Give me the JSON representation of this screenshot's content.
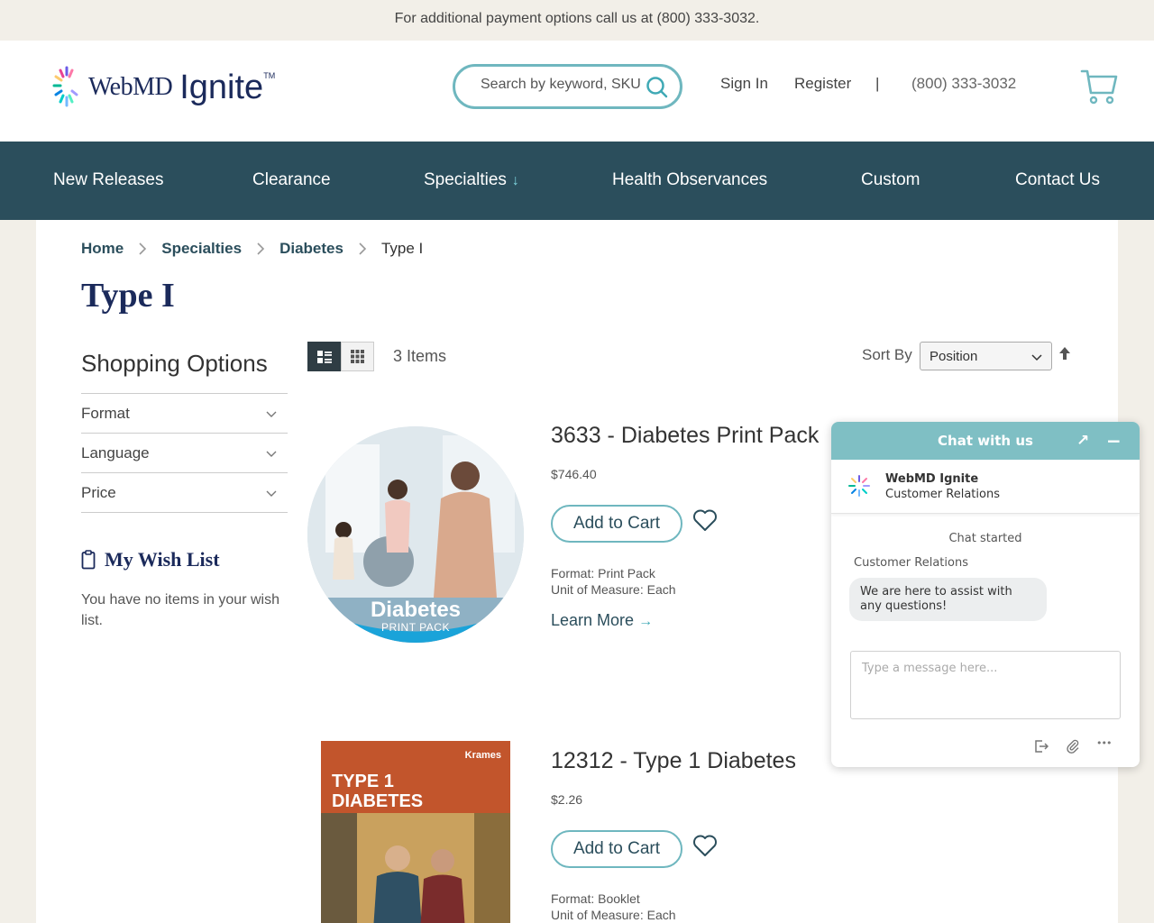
{
  "topbar": {
    "text": "For additional payment options call us at (800) 333-3032."
  },
  "header": {
    "logo_webmd": "WebMD",
    "logo_ignite": "Ignite",
    "logo_tm": "TM",
    "search_placeholder": "Search by keyword, SKU",
    "sign_in": "Sign In",
    "register": "Register",
    "divider": "|",
    "phone": "(800) 333-3032",
    "cart_icon": "cart-icon"
  },
  "nav": {
    "items": [
      {
        "label": "New Releases"
      },
      {
        "label": "Clearance"
      },
      {
        "label": "Specialties",
        "arrow": "↓"
      },
      {
        "label": "Health Observances"
      },
      {
        "label": "Custom"
      },
      {
        "label": "Contact Us"
      }
    ]
  },
  "breadcrumb": [
    {
      "label": "Home"
    },
    {
      "label": "Specialties"
    },
    {
      "label": "Diabetes"
    },
    {
      "label": "Type I"
    }
  ],
  "page_title": "Type I",
  "sidebar": {
    "shopping_options_title": "Shopping Options",
    "filters": [
      {
        "label": "Format"
      },
      {
        "label": "Language"
      },
      {
        "label": "Price"
      }
    ],
    "wishlist_title": "My Wish List",
    "wishlist_text": "You have no items in your wish list."
  },
  "toolbar": {
    "item_count": "3 Items",
    "sort_label": "Sort By",
    "sort_value": "Position",
    "sort_direction_icon": "arrow-up-icon"
  },
  "products": [
    {
      "title": "3633 - Diabetes Print Pack",
      "price": "$746.40",
      "add_to_cart": "Add to Cart",
      "format": "Format: Print Pack",
      "unit": "Unit of Measure: Each",
      "learn_more": "Learn More",
      "learn_more_arrow": "→",
      "image_text_main": "Diabetes",
      "image_text_sub": "PRINT PACK"
    },
    {
      "title": "12312 - Type 1 Diabetes",
      "price": "$2.26",
      "add_to_cart": "Add to Cart",
      "format": "Format: Booklet",
      "unit": "Unit of Measure: Each",
      "image_brand": "Krames",
      "image_title_line1": "TYPE 1",
      "image_title_line2": "DIABETES"
    }
  ],
  "chat": {
    "title": "Chat with us",
    "expand_icon": "↗",
    "minimize_icon": "−",
    "agent_name": "WebMD Ignite",
    "agent_role": "Customer Relations",
    "status": "Chat started",
    "from": "Customer Relations",
    "message": "We are here to assist with any questions!",
    "input_placeholder": "Type a message here...",
    "more_icon": "•••"
  },
  "colors": {
    "nav_bg": "#2b4e5c",
    "accent": "#6fb7bf",
    "title_navy": "#1b2a5b",
    "chat_header": "#7fbfc4"
  }
}
